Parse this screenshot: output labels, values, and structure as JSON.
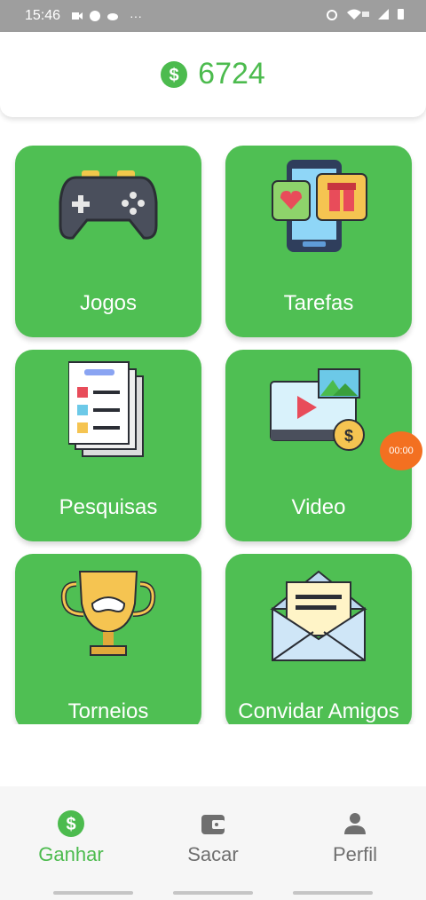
{
  "status_bar": {
    "time": "15:46",
    "more": "···"
  },
  "header": {
    "balance": "6724"
  },
  "tiles": [
    {
      "label": "Jogos",
      "icon": "gamepad-icon"
    },
    {
      "label": "Tarefas",
      "icon": "phone-gift-icon"
    },
    {
      "label": "Pesquisas",
      "icon": "survey-icon"
    },
    {
      "label": "Video",
      "icon": "video-coin-icon"
    },
    {
      "label": "Torneios",
      "icon": "trophy-icon"
    },
    {
      "label": "Convidar Amigos",
      "icon": "envelope-icon"
    }
  ],
  "timer": {
    "text": "00:00"
  },
  "bottom_nav": [
    {
      "label": "Ganhar",
      "icon": "dollar-icon",
      "active": true
    },
    {
      "label": "Sacar",
      "icon": "wallet-icon",
      "active": false
    },
    {
      "label": "Perfil",
      "icon": "person-icon",
      "active": false
    }
  ],
  "colors": {
    "accent": "#4cbb4e",
    "tile": "#4fbf53",
    "timer": "#f37021"
  }
}
